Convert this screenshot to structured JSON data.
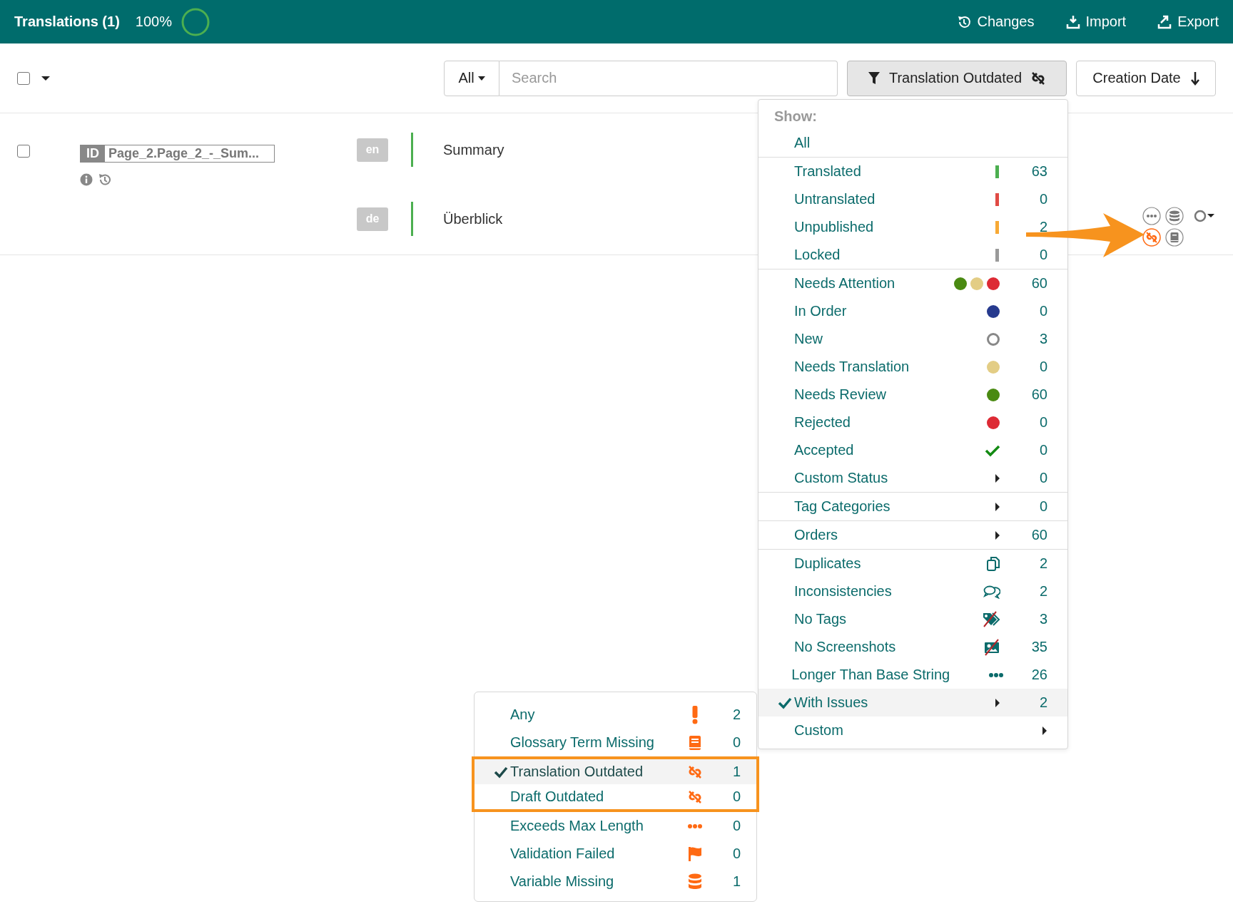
{
  "header": {
    "title": "Translations (1)",
    "progress": "100%",
    "actions": [
      {
        "kind": "history",
        "label": "Changes"
      },
      {
        "kind": "import",
        "label": "Import"
      },
      {
        "kind": "export",
        "label": "Export"
      }
    ]
  },
  "toolbar": {
    "select_all_checked": false,
    "scope": "All",
    "search": {
      "placeholder": "Search"
    },
    "filter": {
      "label": "Translation Outdated"
    },
    "sort": {
      "label": "Creation Date"
    }
  },
  "rows": [
    {
      "checked": false,
      "id_label": "ID",
      "key": "Page_2.Page_2_-_Sum...",
      "translations": [
        {
          "lang": "en",
          "text": "Summary"
        },
        {
          "lang": "de",
          "text": "Überblick"
        }
      ]
    }
  ],
  "filter_menu": {
    "heading": "Show:",
    "groups": [
      {
        "items": [
          {
            "label": "All",
            "selected": false
          }
        ]
      },
      {
        "items": [
          {
            "label": "Translated",
            "selected": false,
            "kind": "bar",
            "color": "#4caf50",
            "count": "63"
          },
          {
            "label": "Untranslated",
            "selected": false,
            "kind": "bar",
            "color": "#e04b45",
            "count": "0"
          },
          {
            "label": "Unpublished",
            "selected": false,
            "kind": "bar",
            "color": "#f7a935",
            "count": "2"
          },
          {
            "label": "Locked",
            "selected": false,
            "kind": "bar",
            "color": "#9a9a9a",
            "count": "0"
          }
        ]
      },
      {
        "items": [
          {
            "label": "Needs Attention",
            "selected": false,
            "kind": "dots",
            "dots": [
              {
                "color": "#4a8a12"
              },
              {
                "color": "#e3cd85"
              },
              {
                "color": "#dd2a34"
              }
            ],
            "count": "60"
          },
          {
            "label": "In Order",
            "selected": false,
            "kind": "dot",
            "color": "#263a8e",
            "count": "0"
          },
          {
            "label": "New",
            "selected": false,
            "kind": "ring",
            "color": "#888888",
            "count": "3"
          },
          {
            "label": "Needs Translation",
            "selected": false,
            "kind": "dot",
            "color": "#e3cd85",
            "count": "0"
          },
          {
            "label": "Needs Review",
            "selected": false,
            "kind": "dot",
            "color": "#4a8a12",
            "count": "60"
          },
          {
            "label": "Rejected",
            "selected": false,
            "kind": "dot",
            "color": "#dd2a34",
            "count": "0"
          },
          {
            "label": "Accepted",
            "selected": false,
            "kind": "check",
            "color": "#138a13",
            "count": "0"
          },
          {
            "label": "Custom Status",
            "selected": false,
            "kind": "caret",
            "count": "0"
          }
        ]
      },
      {
        "items": [
          {
            "label": "Tag Categories",
            "selected": false,
            "kind": "caret",
            "count": "0"
          }
        ]
      },
      {
        "items": [
          {
            "label": "Orders",
            "selected": false,
            "kind": "caret",
            "count": "60"
          }
        ]
      },
      {
        "items": [
          {
            "label": "Duplicates",
            "selected": false,
            "kind": "duplicate",
            "count": "2"
          },
          {
            "label": "Inconsistencies",
            "selected": false,
            "kind": "comments",
            "count": "2"
          },
          {
            "label": "No Tags",
            "selected": false,
            "kind": "no-tags",
            "count": "3"
          },
          {
            "label": "No Screenshots",
            "selected": false,
            "kind": "no-screenshots",
            "count": "35"
          },
          {
            "label": "Longer Than Base String",
            "selected": false,
            "kind": "ellipsis",
            "count": "26"
          },
          {
            "label": "With Issues",
            "selected": true,
            "kind": "caret",
            "count": "2"
          },
          {
            "label": "Custom",
            "selected": false,
            "kind": "caret"
          }
        ]
      }
    ]
  },
  "issues_submenu": {
    "items": [
      {
        "label": "Any",
        "selected": false,
        "highlighted": false,
        "kind": "exclamation",
        "count": "2"
      },
      {
        "label": "Glossary Term Missing",
        "selected": false,
        "highlighted": false,
        "kind": "book",
        "count": "0"
      },
      {
        "label": "Translation Outdated",
        "selected": true,
        "highlighted": true,
        "kind": "unlink",
        "count": "1"
      },
      {
        "label": "Draft Outdated",
        "selected": false,
        "highlighted": true,
        "kind": "unlink",
        "count": "0"
      },
      {
        "label": "Exceeds Max Length",
        "selected": false,
        "highlighted": false,
        "kind": "ellipsis",
        "count": "0"
      },
      {
        "label": "Validation Failed",
        "selected": false,
        "highlighted": false,
        "kind": "flag",
        "count": "0"
      },
      {
        "label": "Variable Missing",
        "selected": false,
        "highlighted": false,
        "kind": "database",
        "count": "1"
      }
    ]
  }
}
